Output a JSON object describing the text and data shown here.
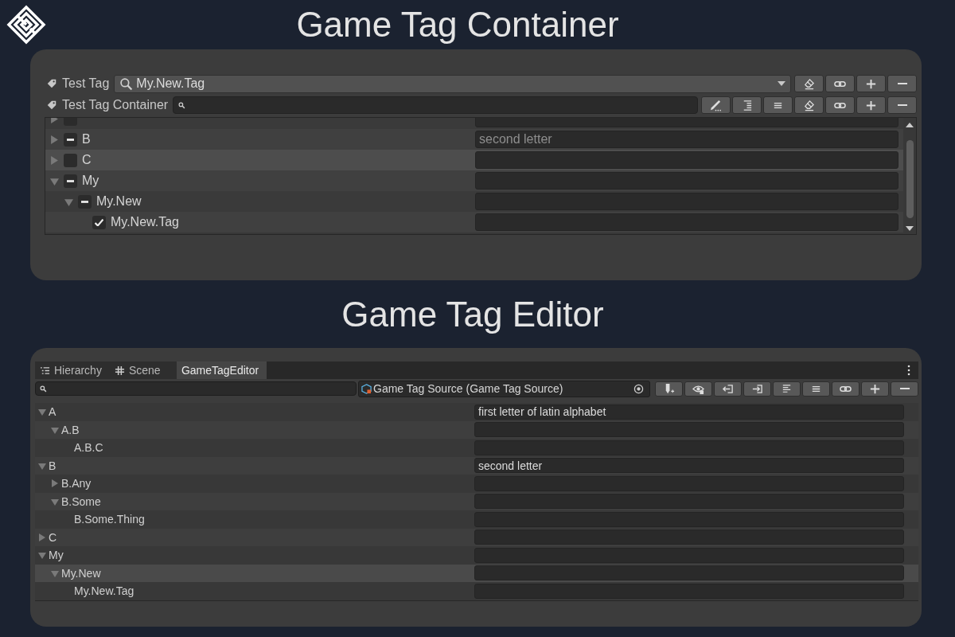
{
  "header": {
    "title": "Game Tag Container"
  },
  "container": {
    "fields": [
      {
        "kind": "dropdown",
        "label": "Test Tag",
        "value": "My.New.Tag",
        "buttons": [
          {
            "kind": "eraser"
          },
          {
            "kind": "link"
          },
          {
            "kind": "plus"
          },
          {
            "kind": "minus"
          }
        ]
      },
      {
        "kind": "search",
        "label": "Test Tag Container",
        "buttons": [
          {
            "kind": "pencil"
          },
          {
            "kind": "indent"
          },
          {
            "kind": "lines"
          },
          {
            "kind": "eraser"
          },
          {
            "kind": "link"
          },
          {
            "kind": "plus"
          },
          {
            "kind": "minus"
          }
        ]
      }
    ],
    "tree": [
      {
        "checked": false,
        "indeterminate": false,
        "expanded": false,
        "selected": false
      },
      {
        "name": "B",
        "checked": false,
        "indeterminate": true,
        "expanded": false,
        "selected": false,
        "description": "second letter"
      },
      {
        "name": "C",
        "checked": false,
        "indeterminate": false,
        "expanded": false,
        "selected": true
      },
      {
        "name": "My",
        "checked": false,
        "indeterminate": true,
        "expanded": true,
        "selected": false,
        "children": [
          {
            "name": "My.New",
            "checked": false,
            "indeterminate": true,
            "expanded": true,
            "selected": false,
            "children": [
              {
                "name": "My.New.Tag",
                "checked": true,
                "indeterminate": false,
                "selected": false
              }
            ]
          }
        ]
      }
    ]
  },
  "editor_header": {
    "title": "Game Tag Editor"
  },
  "editor": {
    "tabs": [
      {
        "label": "Hierarchy",
        "kind": "list",
        "selected": false
      },
      {
        "label": "Scene",
        "kind": "grid",
        "selected": false
      },
      {
        "label": "GameTagEditor",
        "kind": "none",
        "selected": true
      }
    ],
    "source": {
      "value": "Game Tag Source (Game Tag Source)"
    },
    "buttons": [
      {
        "kind": "marker"
      },
      {
        "kind": "eye"
      },
      {
        "kind": "exit"
      },
      {
        "kind": "enter"
      },
      {
        "kind": "align"
      },
      {
        "kind": "lines"
      },
      {
        "kind": "link"
      },
      {
        "kind": "plus"
      },
      {
        "kind": "minus"
      }
    ],
    "tree": [
      {
        "name": "A",
        "expanded": true,
        "selected": false,
        "description": "first letter of latin alphabet",
        "children": [
          {
            "name": "A.B",
            "expanded": true,
            "selected": false,
            "children": [
              {
                "name": "A.B.C",
                "selected": false
              }
            ]
          }
        ]
      },
      {
        "name": "B",
        "expanded": true,
        "selected": false,
        "description": "second letter",
        "children": [
          {
            "name": "B.Any",
            "expanded": false,
            "selected": false
          },
          {
            "name": "B.Some",
            "expanded": true,
            "selected": false,
            "children": [
              {
                "name": "B.Some.Thing",
                "selected": false
              }
            ]
          }
        ]
      },
      {
        "name": "C",
        "expanded": false,
        "selected": false
      },
      {
        "name": "My",
        "expanded": true,
        "selected": false,
        "children": [
          {
            "name": "My.New",
            "expanded": true,
            "selected": true,
            "children": [
              {
                "name": "My.New.Tag",
                "selected": false
              }
            ]
          }
        ]
      }
    ]
  }
}
